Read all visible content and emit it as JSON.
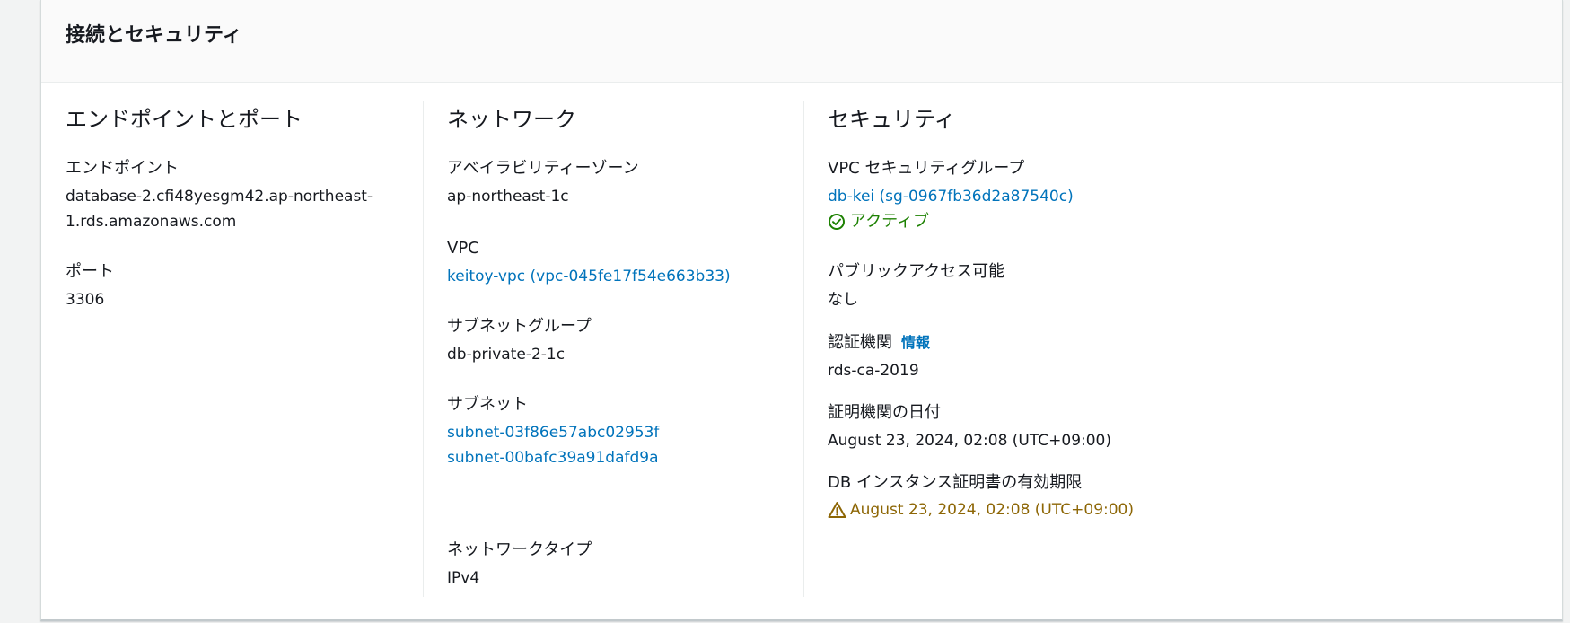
{
  "panel": {
    "title": "接続とセキュリティ"
  },
  "endpoint_section": {
    "title": "エンドポイントとポート",
    "endpoint_label": "エンドポイント",
    "endpoint_line1": "database-2.cfi48yesgm42.ap-northeast-",
    "endpoint_line2": "1.rds.amazonaws.com",
    "port_label": "ポート",
    "port_value": "3306"
  },
  "network_section": {
    "title": "ネットワーク",
    "az_label": "アベイラビリティーゾーン",
    "az_value": "ap-northeast-1c",
    "vpc_label": "VPC",
    "vpc_value": "keitoy-vpc (vpc-045fe17f54e663b33)",
    "subnet_group_label": "サブネットグループ",
    "subnet_group_value": "db-private-2-1c",
    "subnets_label": "サブネット",
    "subnets": [
      "subnet-03f86e57abc02953f",
      "subnet-00bafc39a91dafd9a"
    ],
    "network_type_label": "ネットワークタイプ",
    "network_type_value": "IPv4"
  },
  "security_section": {
    "title": "セキュリティ",
    "vpc_sg_label": "VPC セキュリティグループ",
    "vpc_sg_value": "db-kei (sg-0967fb36d2a87540c)",
    "vpc_sg_status": "アクティブ",
    "public_access_label": "パブリックアクセス可能",
    "public_access_value": "なし",
    "ca_label": "認証機関",
    "ca_info_link": "情報",
    "ca_value": "rds-ca-2019",
    "ca_date_label": "証明機関の日付",
    "ca_date_value": "August 23, 2024, 02:08 (UTC+09:00)",
    "cert_expiry_label": "DB インスタンス証明書の有効期限",
    "cert_expiry_value": "August 23, 2024, 02:08 (UTC+09:00)"
  },
  "colors": {
    "link": "#0073bb",
    "success": "#1d8102",
    "warning": "#8d6605"
  },
  "icons": {
    "status_ok": "check-circle-icon",
    "status_warn": "warning-triangle-icon"
  }
}
